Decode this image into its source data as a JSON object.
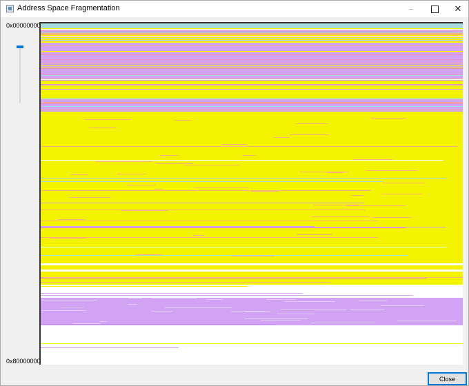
{
  "window": {
    "title": "Address Space Fragmentation",
    "close_label": "Close"
  },
  "address_range": {
    "start": "0x00000000",
    "end": "0x80000000"
  },
  "colors": {
    "free": "#ffffff",
    "image": "#f4f400",
    "private": "#d2a2f4",
    "mapped": "#a8dcdc",
    "heap": "#f8b080",
    "thread": "#f08cb4",
    "accent": "#0078d7"
  },
  "icons": {
    "app": "app-icon",
    "minimize": "minimize-icon",
    "maximize": "maximize-icon",
    "close": "close-icon"
  },
  "zoom_slider": {
    "level": 0
  }
}
